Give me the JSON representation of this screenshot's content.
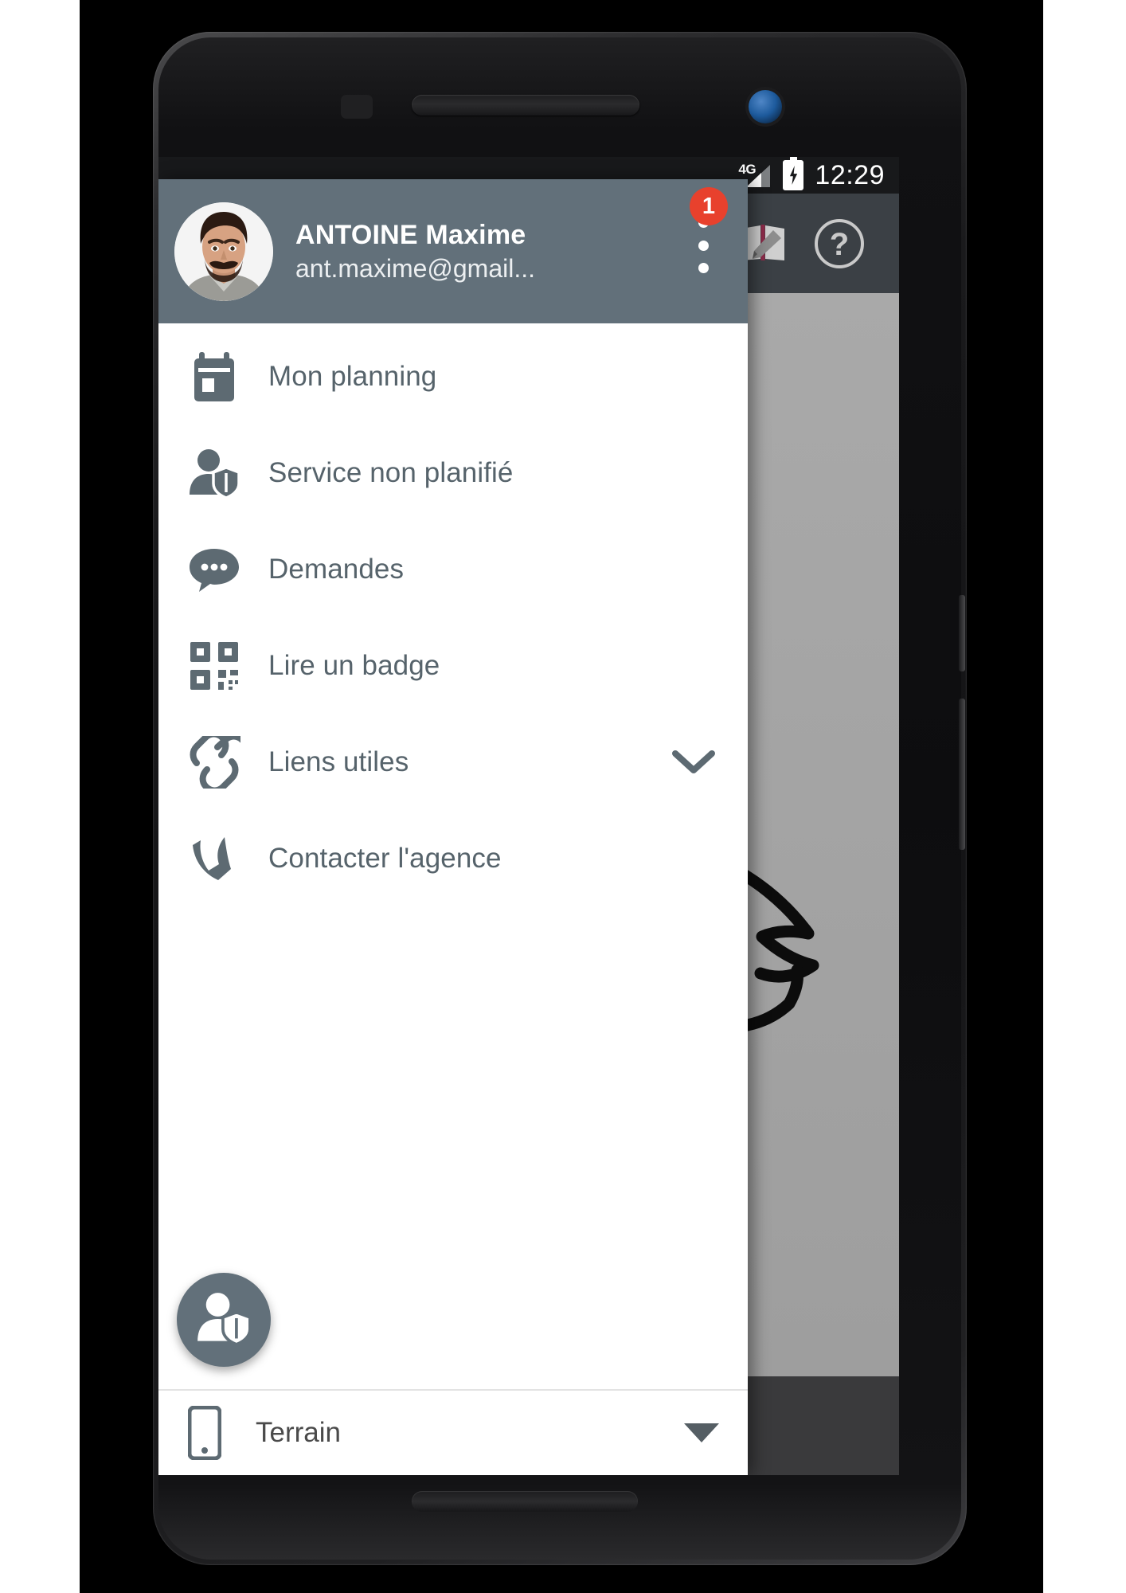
{
  "status_bar": {
    "network_label": "4G",
    "signal_icon": "signal-bars-icon",
    "battery_icon": "battery-charging-icon",
    "clock": "12:29"
  },
  "app": {
    "toolbar": {
      "icons": [
        {
          "name": "logbook-icon",
          "label": "Journal"
        },
        {
          "name": "help-icon",
          "label": "?"
        }
      ]
    },
    "background_logo": "lynx-head-logo",
    "bottom_bar": {
      "call_icon": "phone-call-icon",
      "accent_color": "#b22222"
    }
  },
  "drawer": {
    "header": {
      "avatar_alt": "user-avatar",
      "user_name": "ANTOINE Maxime",
      "user_email": "ant.maxime@gmail...",
      "overflow_icon": "overflow-menu-icon",
      "notification_count": "1",
      "badge_color": "#e8412d",
      "background_color": "#62707a"
    },
    "items": [
      {
        "icon": "calendar-icon",
        "label": "Mon planning",
        "expandable": false
      },
      {
        "icon": "user-shield-icon",
        "label": "Service non planifié",
        "expandable": false
      },
      {
        "icon": "chat-bubble-icon",
        "label": "Demandes",
        "expandable": false
      },
      {
        "icon": "qr-code-icon",
        "label": "Lire un badge",
        "expandable": false
      },
      {
        "icon": "link-chain-icon",
        "label": "Liens utiles",
        "expandable": true
      },
      {
        "icon": "phone-handset-icon",
        "label": "Contacter l'agence",
        "expandable": false
      }
    ],
    "fab": {
      "icon": "user-shield-icon",
      "color": "#62707a"
    },
    "footer": {
      "icon": "mobile-device-icon",
      "selected_value": "Terrain",
      "caret_icon": "caret-down-icon"
    }
  },
  "device": {
    "earpiece": "earpiece-speaker",
    "front_camera": "front-camera-lens",
    "proximity_sensor": "proximity-sensor",
    "bottom_speaker": "bottom-speaker"
  }
}
